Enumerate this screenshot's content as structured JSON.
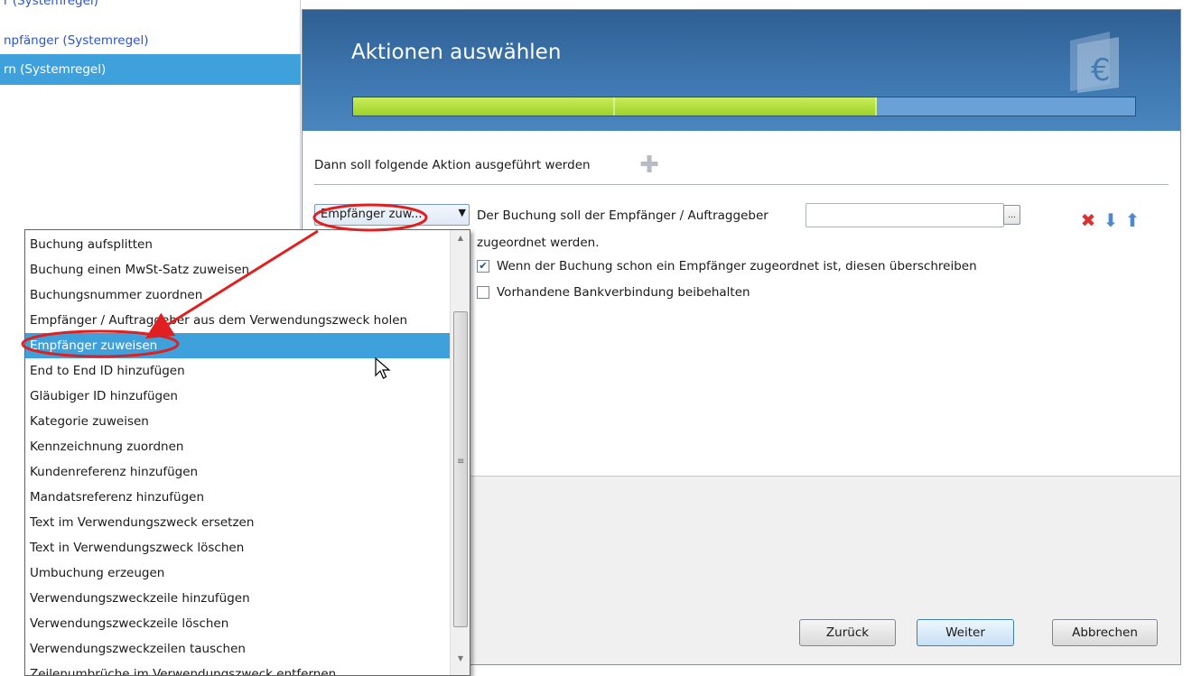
{
  "rules_list": {
    "items": [
      {
        "label": "r (Systemregel)"
      },
      {
        "label": "npfänger (Systemregel)"
      },
      {
        "label": "rn (Systemregel)"
      }
    ]
  },
  "dialog": {
    "title": "Aktionen auswählen",
    "progress": {
      "fraction": 0.67,
      "segments": 3
    },
    "section_label": "Dann soll folgende Aktion ausgeführt werden",
    "action_select": {
      "value": "Empfänger zuw..."
    },
    "description_line1": "Der Buchung soll der Empfänger / Auftraggeber",
    "description_line2": "zugeordnet werden.",
    "recipient_field": {
      "value": ""
    },
    "browse_label": "...",
    "checkboxes": [
      {
        "label": "Wenn der Buchung schon ein Empfänger zugeordnet ist, diesen überschreiben",
        "checked": true
      },
      {
        "label": "Vorhandene Bankverbindung beibehalten",
        "checked": false
      }
    ],
    "buttons": {
      "back": "Zurück",
      "next": "Weiter",
      "cancel": "Abbrechen"
    }
  },
  "dropdown": {
    "selected_index": 4,
    "items": [
      "Buchung aufsplitten",
      "Buchung einen MwSt-Satz zuweisen",
      "Buchungsnummer zuordnen",
      "Empfänger / Auftraggeber aus dem Verwendungszweck holen",
      "Empfänger zuweisen",
      "End to End ID hinzufügen",
      "Gläubiger ID hinzufügen",
      "Kategorie zuweisen",
      "Kennzeichnung zuordnen",
      "Kundenreferenz hinzufügen",
      "Mandatsreferenz hinzufügen",
      "Text im Verwendungszweck ersetzen",
      "Text in Verwendungszweck löschen",
      "Umbuchung erzeugen",
      "Verwendungszweckzeile hinzufügen",
      "Verwendungszweckzeile löschen",
      "Verwendungszweckzeilen tauschen",
      "Zeilenumbrüche im Verwendungszweck entfernen"
    ]
  },
  "icons": {
    "add": "plus-icon",
    "delete": "delete-icon",
    "move_down": "arrow-down-icon",
    "move_up": "arrow-up-icon",
    "logo": "euro-logo-icon",
    "cursor": "mouse-cursor-icon"
  },
  "colors": {
    "selection_blue": "#3fa1dc",
    "header_blue": "#3d76ae",
    "progress_green": "#9fd327",
    "annotation_red": "#e02020",
    "link_blue": "#2b55c9"
  }
}
